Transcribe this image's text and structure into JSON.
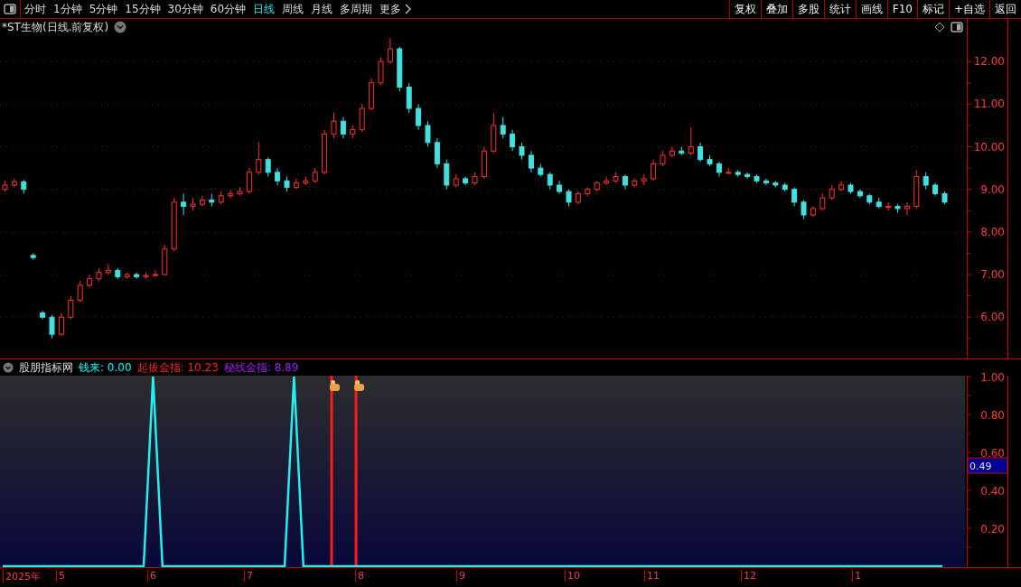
{
  "toolbar": {
    "periods": [
      {
        "label": "分时",
        "selected": false
      },
      {
        "label": "1分钟",
        "selected": false
      },
      {
        "label": "5分钟",
        "selected": false
      },
      {
        "label": "15分钟",
        "selected": false
      },
      {
        "label": "30分钟",
        "selected": false
      },
      {
        "label": "60分钟",
        "selected": false
      },
      {
        "label": "日线",
        "selected": true
      },
      {
        "label": "周线",
        "selected": false
      },
      {
        "label": "月线",
        "selected": false
      },
      {
        "label": "多周期",
        "selected": false
      },
      {
        "label": "更多",
        "selected": false
      }
    ],
    "actions": [
      "复权",
      "叠加",
      "多股",
      "统计",
      "画线",
      "F10",
      "标记",
      "+自选",
      "返回"
    ]
  },
  "chart": {
    "title": "*ST生物(日线.前复权)",
    "chart_data": {
      "type": "candlestick",
      "ohlc": [
        [
          9.0,
          9.2,
          8.95,
          9.1
        ],
        [
          9.1,
          9.25,
          9.05,
          9.18
        ],
        [
          9.18,
          9.22,
          8.9,
          9.0
        ],
        [
          7.45,
          7.5,
          7.35,
          7.4
        ],
        [
          6.1,
          6.15,
          5.95,
          6.0
        ],
        [
          6.0,
          6.05,
          5.5,
          5.6
        ],
        [
          5.6,
          6.1,
          5.55,
          6.0
        ],
        [
          6.0,
          6.5,
          5.95,
          6.4
        ],
        [
          6.4,
          6.85,
          6.35,
          6.75
        ],
        [
          6.75,
          7.0,
          6.7,
          6.9
        ],
        [
          6.9,
          7.15,
          6.85,
          7.05
        ],
        [
          7.05,
          7.25,
          7.0,
          7.1
        ],
        [
          7.1,
          7.15,
          6.9,
          6.95
        ],
        [
          6.95,
          7.05,
          6.9,
          7.0
        ],
        [
          7.0,
          7.05,
          6.9,
          6.95
        ],
        [
          6.95,
          7.05,
          6.9,
          6.98
        ],
        [
          6.98,
          7.1,
          6.95,
          7.0
        ],
        [
          7.0,
          7.7,
          6.98,
          7.6
        ],
        [
          7.6,
          8.8,
          7.55,
          8.7
        ],
        [
          8.7,
          8.9,
          8.4,
          8.6
        ],
        [
          8.6,
          8.8,
          8.5,
          8.65
        ],
        [
          8.65,
          8.85,
          8.6,
          8.75
        ],
        [
          8.75,
          8.9,
          8.6,
          8.7
        ],
        [
          8.7,
          8.95,
          8.65,
          8.85
        ],
        [
          8.85,
          9.0,
          8.8,
          8.9
        ],
        [
          8.9,
          9.05,
          8.85,
          8.95
        ],
        [
          8.95,
          9.5,
          8.9,
          9.4
        ],
        [
          9.4,
          10.1,
          9.35,
          9.7
        ],
        [
          9.7,
          9.75,
          9.3,
          9.4
        ],
        [
          9.4,
          9.5,
          9.1,
          9.2
        ],
        [
          9.2,
          9.3,
          8.95,
          9.05
        ],
        [
          9.05,
          9.25,
          9.0,
          9.15
        ],
        [
          9.15,
          9.3,
          9.1,
          9.2
        ],
        [
          9.2,
          9.5,
          9.15,
          9.4
        ],
        [
          9.4,
          10.4,
          9.35,
          10.3
        ],
        [
          10.3,
          10.8,
          10.2,
          10.6
        ],
        [
          10.6,
          10.7,
          10.2,
          10.3
        ],
        [
          10.3,
          10.5,
          10.2,
          10.4
        ],
        [
          10.4,
          11.0,
          10.35,
          10.9
        ],
        [
          10.9,
          11.6,
          10.85,
          11.5
        ],
        [
          11.5,
          12.1,
          11.45,
          12.0
        ],
        [
          12.0,
          12.55,
          11.95,
          12.3
        ],
        [
          12.3,
          12.35,
          11.3,
          11.4
        ],
        [
          11.4,
          11.5,
          10.8,
          10.9
        ],
        [
          10.9,
          11.0,
          10.4,
          10.5
        ],
        [
          10.5,
          10.6,
          10.0,
          10.1
        ],
        [
          10.1,
          10.2,
          9.5,
          9.6
        ],
        [
          9.6,
          9.7,
          9.0,
          9.1
        ],
        [
          9.1,
          9.35,
          9.05,
          9.25
        ],
        [
          9.25,
          9.3,
          9.1,
          9.15
        ],
        [
          9.15,
          9.4,
          9.1,
          9.3
        ],
        [
          9.3,
          10.0,
          9.25,
          9.9
        ],
        [
          9.9,
          10.8,
          9.85,
          10.5
        ],
        [
          10.5,
          10.7,
          10.2,
          10.3
        ],
        [
          10.3,
          10.4,
          9.9,
          10.0
        ],
        [
          10.0,
          10.1,
          9.7,
          9.8
        ],
        [
          9.8,
          9.9,
          9.4,
          9.5
        ],
        [
          9.5,
          9.6,
          9.3,
          9.35
        ],
        [
          9.35,
          9.4,
          9.0,
          9.1
        ],
        [
          9.1,
          9.2,
          8.9,
          8.95
        ],
        [
          8.95,
          9.0,
          8.6,
          8.7
        ],
        [
          8.7,
          8.95,
          8.65,
          8.9
        ],
        [
          8.9,
          9.05,
          8.85,
          9.0
        ],
        [
          9.0,
          9.2,
          8.95,
          9.15
        ],
        [
          9.15,
          9.3,
          9.1,
          9.2
        ],
        [
          9.2,
          9.4,
          9.15,
          9.3
        ],
        [
          9.3,
          9.35,
          9.0,
          9.1
        ],
        [
          9.1,
          9.25,
          9.05,
          9.2
        ],
        [
          9.2,
          9.35,
          9.1,
          9.25
        ],
        [
          9.25,
          9.7,
          9.2,
          9.6
        ],
        [
          9.6,
          9.9,
          9.55,
          9.8
        ],
        [
          9.8,
          10.0,
          9.75,
          9.9
        ],
        [
          9.9,
          10.0,
          9.8,
          9.85
        ],
        [
          9.85,
          10.45,
          9.8,
          10.0
        ],
        [
          10.0,
          10.1,
          9.65,
          9.7
        ],
        [
          9.7,
          9.8,
          9.55,
          9.6
        ],
        [
          9.6,
          9.65,
          9.3,
          9.4
        ],
        [
          9.4,
          9.5,
          9.35,
          9.4
        ],
        [
          9.4,
          9.45,
          9.3,
          9.35
        ],
        [
          9.35,
          9.4,
          9.25,
          9.3
        ],
        [
          9.3,
          9.35,
          9.15,
          9.2
        ],
        [
          9.2,
          9.25,
          9.1,
          9.15
        ],
        [
          9.15,
          9.2,
          9.05,
          9.1
        ],
        [
          9.1,
          9.15,
          8.95,
          9.0
        ],
        [
          9.0,
          9.05,
          8.6,
          8.7
        ],
        [
          8.7,
          8.75,
          8.3,
          8.4
        ],
        [
          8.4,
          8.6,
          8.35,
          8.55
        ],
        [
          8.55,
          8.9,
          8.5,
          8.8
        ],
        [
          8.8,
          9.1,
          8.75,
          9.0
        ],
        [
          9.0,
          9.2,
          8.95,
          9.1
        ],
        [
          9.1,
          9.15,
          8.9,
          8.95
        ],
        [
          8.95,
          9.0,
          8.8,
          8.85
        ],
        [
          8.85,
          8.9,
          8.65,
          8.7
        ],
        [
          8.7,
          8.8,
          8.55,
          8.6
        ],
        [
          8.6,
          8.7,
          8.5,
          8.6
        ],
        [
          8.6,
          8.65,
          8.45,
          8.55
        ],
        [
          8.55,
          8.7,
          8.4,
          8.6
        ],
        [
          8.6,
          9.45,
          8.55,
          9.3
        ],
        [
          9.3,
          9.4,
          9.0,
          9.1
        ],
        [
          9.1,
          9.15,
          8.85,
          8.9
        ],
        [
          8.9,
          8.95,
          8.65,
          8.7
        ]
      ],
      "grid": true,
      "ylim": [
        5.03,
        13.0
      ],
      "yticks": [
        {
          "value": 12,
          "label": "12.00"
        },
        {
          "value": 11,
          "label": "11.00"
        },
        {
          "value": 10,
          "label": "10.00"
        },
        {
          "value": 9,
          "label": "9.00"
        },
        {
          "value": 8,
          "label": "8.00"
        },
        {
          "value": 7,
          "label": "7.00"
        },
        {
          "value": 6,
          "label": "6.00"
        }
      ]
    }
  },
  "indicator": {
    "name": "股朋指标网",
    "values": [
      {
        "text": "钱来: 0.00",
        "color": "#00ffff"
      },
      {
        "text": "起拔金指: 10.23",
        "color": "#ff2020"
      },
      {
        "text": "秘线金指: 8.89",
        "color": "#a020f0"
      }
    ],
    "cursor_value": "0.49",
    "chart_data": {
      "type": "line",
      "series": [
        {
          "color": "#20f0f0",
          "values": [
            0,
            0,
            0,
            0,
            0,
            0,
            0,
            0,
            0,
            0,
            0,
            0,
            0,
            0,
            0,
            0,
            1,
            0,
            0,
            0,
            0,
            0,
            0,
            0,
            0,
            0,
            0,
            0,
            0,
            0,
            0,
            1,
            0,
            0,
            0,
            0,
            0,
            0,
            0,
            0,
            0,
            0,
            0,
            0,
            0,
            0,
            0,
            0,
            0,
            0,
            0,
            0,
            0,
            0,
            0,
            0,
            0,
            0,
            0,
            0,
            0,
            0,
            0,
            0,
            0,
            0,
            0,
            0,
            0,
            0,
            0,
            0,
            0,
            0,
            0,
            0,
            0,
            0,
            0,
            0,
            0,
            0,
            0,
            0,
            0,
            0,
            0,
            0,
            0,
            0,
            0,
            0,
            0,
            0,
            0,
            0,
            0,
            0,
            0,
            0,
            0
          ]
        }
      ],
      "ylim": [
        0,
        1
      ],
      "yticks": [
        {
          "value": 1,
          "label": "1.00"
        },
        {
          "value": 0.8,
          "label": "0.80"
        },
        {
          "value": 0.6,
          "label": "0.60"
        },
        {
          "value": 0.4,
          "label": "0.40"
        },
        {
          "value": 0.2,
          "label": "0.20"
        }
      ]
    }
  },
  "date_axis": [
    "2025年",
    "5",
    "6",
    "7",
    "8",
    "9",
    "10",
    "11",
    "12",
    "1"
  ]
}
